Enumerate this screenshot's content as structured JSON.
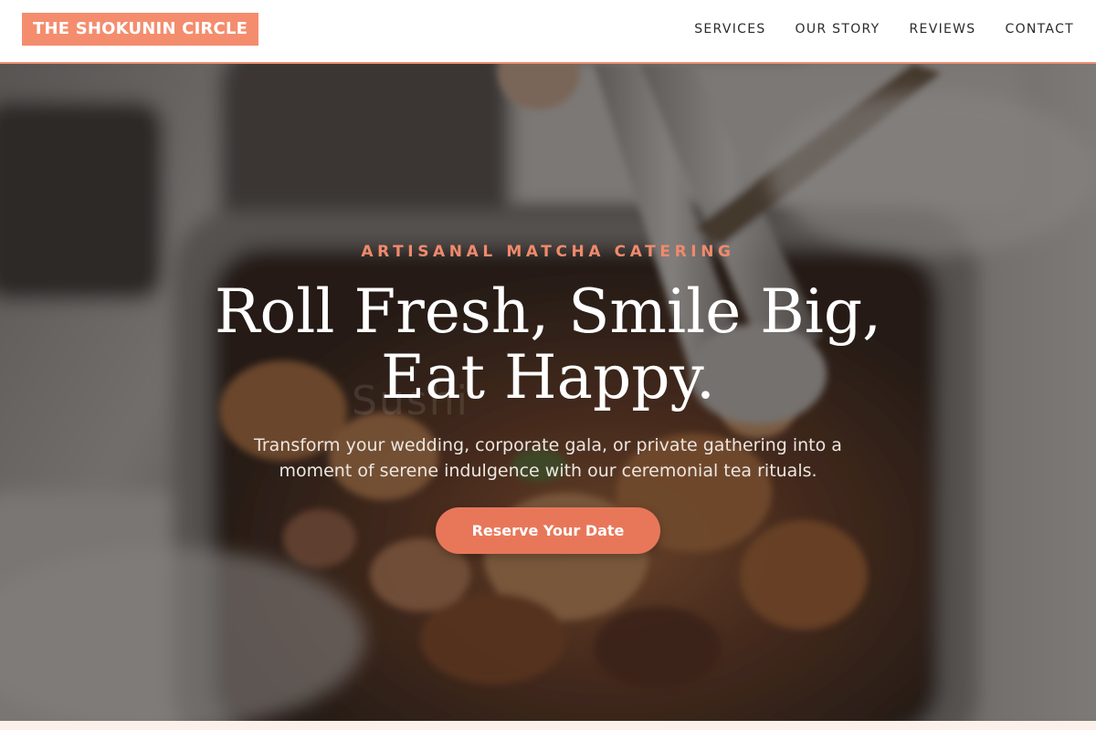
{
  "header": {
    "logo": "THE SHOKUNIN CIRCLE",
    "nav": [
      {
        "label": "SERVICES"
      },
      {
        "label": "OUR STORY"
      },
      {
        "label": "REVIEWS"
      },
      {
        "label": "CONTACT"
      }
    ]
  },
  "hero": {
    "kicker": "ARTISANAL MATCHA CATERING",
    "headline": "Roll Fresh, Smile Big, Eat Happy.",
    "ghost_text": "Sushi",
    "subtext": "Transform your wedding, corporate gala, or private gathering into a moment of serene indulgence with our ceremonial tea rituals.",
    "cta_label": "Reserve Your Date",
    "image_description": "blurred photo of tongs serving food from a stainless steel catering tray"
  },
  "colors": {
    "accent": "#f48d6e",
    "cta": "#e8775a",
    "header_bg": "#ffffff",
    "header_border": "#ee8e72",
    "overlay": "#1c1816"
  }
}
